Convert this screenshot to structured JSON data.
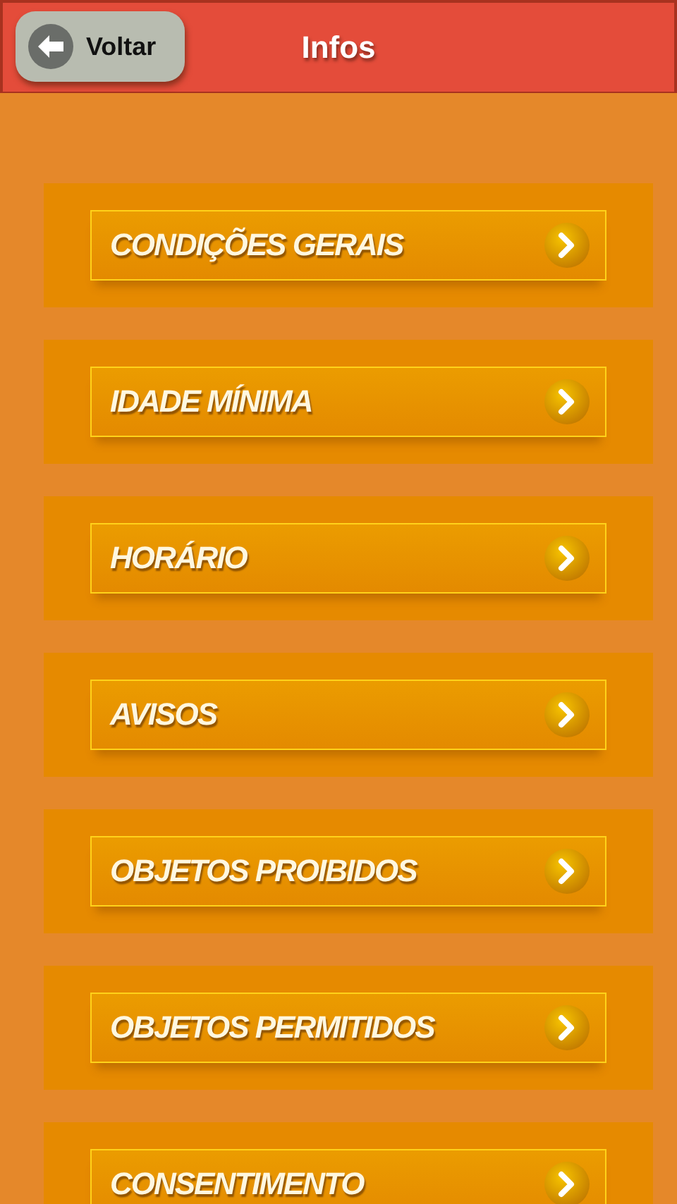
{
  "header": {
    "back_button": "Voltar",
    "title": "Infos"
  },
  "items": [
    {
      "label": "CONDIÇÕES GERAIS"
    },
    {
      "label": "IDADE MÍNIMA"
    },
    {
      "label": "HORÁRIO"
    },
    {
      "label": "AVISOS"
    },
    {
      "label": "OBJETOS PROIBIDOS"
    },
    {
      "label": "OBJETOS PERMITIDOS"
    },
    {
      "label": "CONSENTIMENTO"
    }
  ]
}
